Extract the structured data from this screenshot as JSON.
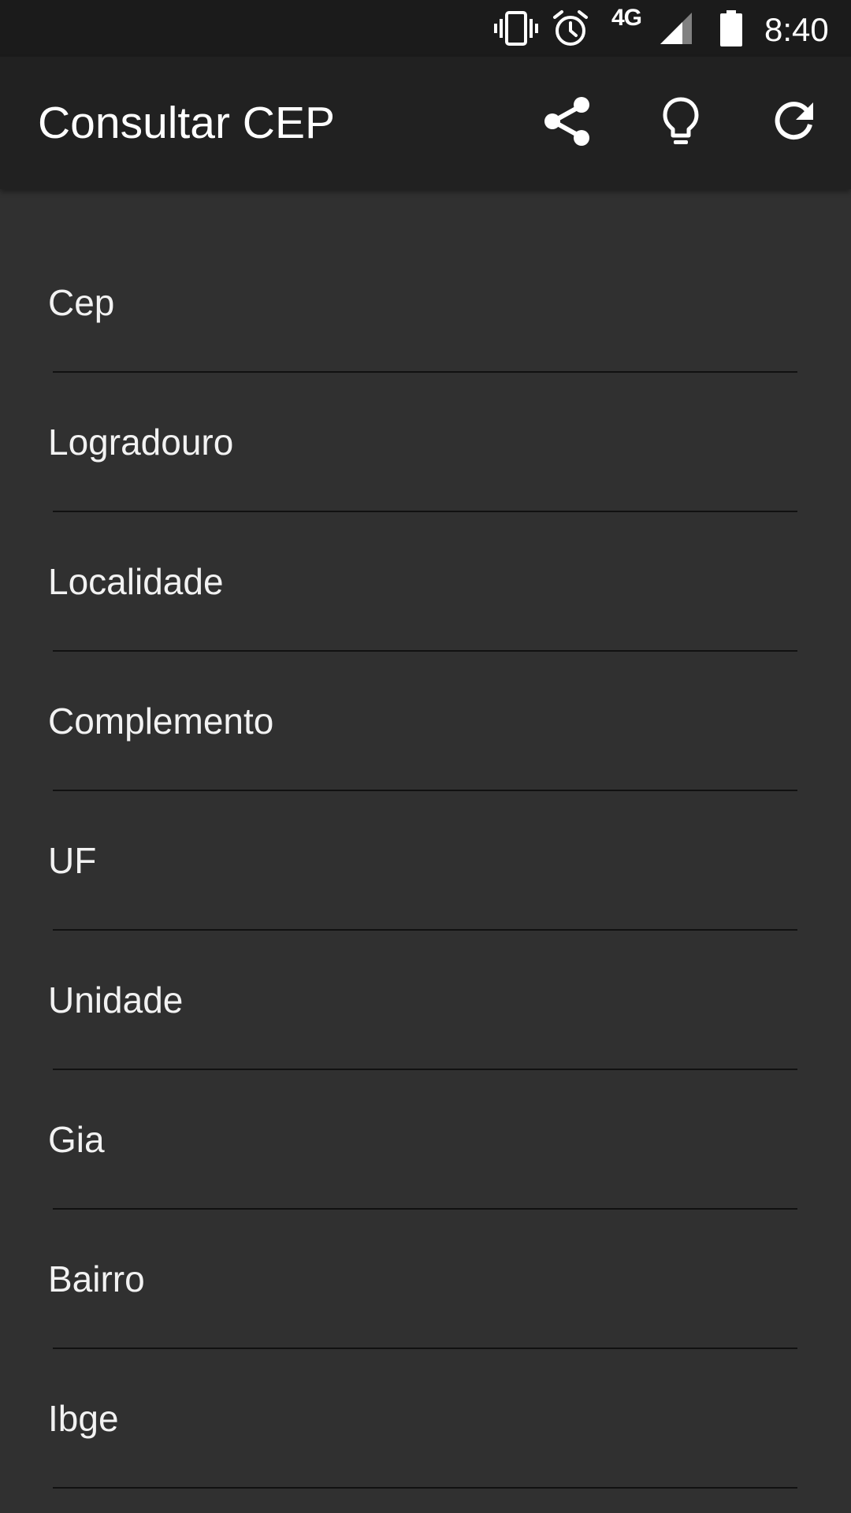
{
  "status_bar": {
    "time": "8:40",
    "network": "4G",
    "icons": [
      "vibrate-icon",
      "alarm-icon",
      "signal-icon",
      "battery-icon"
    ]
  },
  "app_bar": {
    "title": "Consultar CEP",
    "actions": [
      "share-icon",
      "lightbulb-icon",
      "refresh-icon"
    ]
  },
  "form": {
    "fields": [
      {
        "placeholder": "Cep",
        "value": ""
      },
      {
        "placeholder": "Logradouro",
        "value": ""
      },
      {
        "placeholder": "Localidade",
        "value": ""
      },
      {
        "placeholder": "Complemento",
        "value": ""
      },
      {
        "placeholder": "UF",
        "value": ""
      },
      {
        "placeholder": "Unidade",
        "value": ""
      },
      {
        "placeholder": "Gia",
        "value": ""
      },
      {
        "placeholder": "Bairro",
        "value": ""
      },
      {
        "placeholder": "Ibge",
        "value": ""
      }
    ]
  },
  "colors": {
    "background": "#303030",
    "app_bar": "#212121",
    "status_bar": "#1b1b1b",
    "text": "#ffffff",
    "divider": "#111111"
  }
}
